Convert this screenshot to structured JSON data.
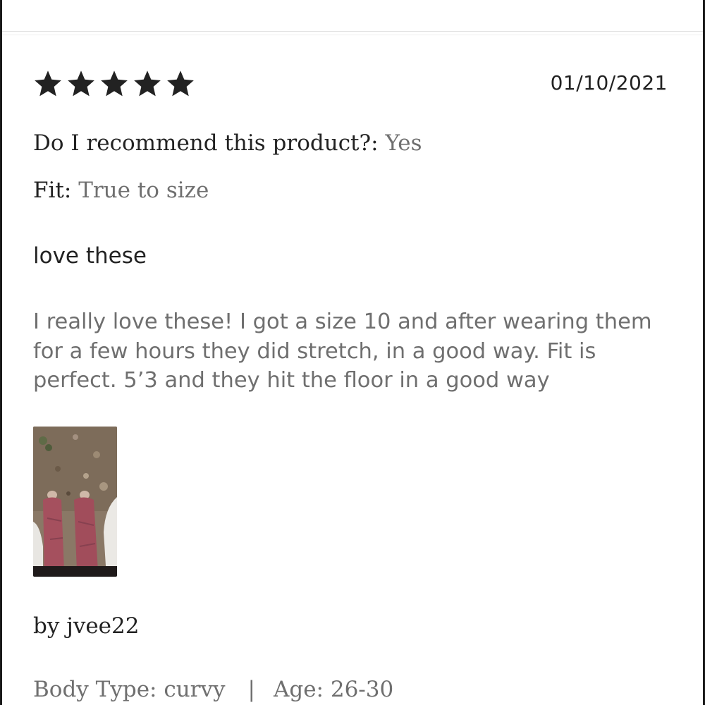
{
  "review": {
    "rating": 5,
    "max_rating": 5,
    "date": "01/10/2021",
    "recommend_label": "Do I recommend this product?:",
    "recommend_value": "Yes",
    "fit_label": "Fit:",
    "fit_value": "True to size",
    "title": "love these",
    "body": "I really love these! I got a size 10 and after wearing them for a few hours they did stretch, in a good way. Fit is perfect. 5’3 and they hit the floor in a good way",
    "author": "by jvee22",
    "body_type": "Body Type: curvy",
    "separator": "|",
    "age": "Age: 26-30"
  },
  "icons": {
    "star": "star-icon"
  },
  "colors": {
    "star": "#222222",
    "primary_text": "#222222",
    "secondary_text": "#6f6f6f"
  }
}
